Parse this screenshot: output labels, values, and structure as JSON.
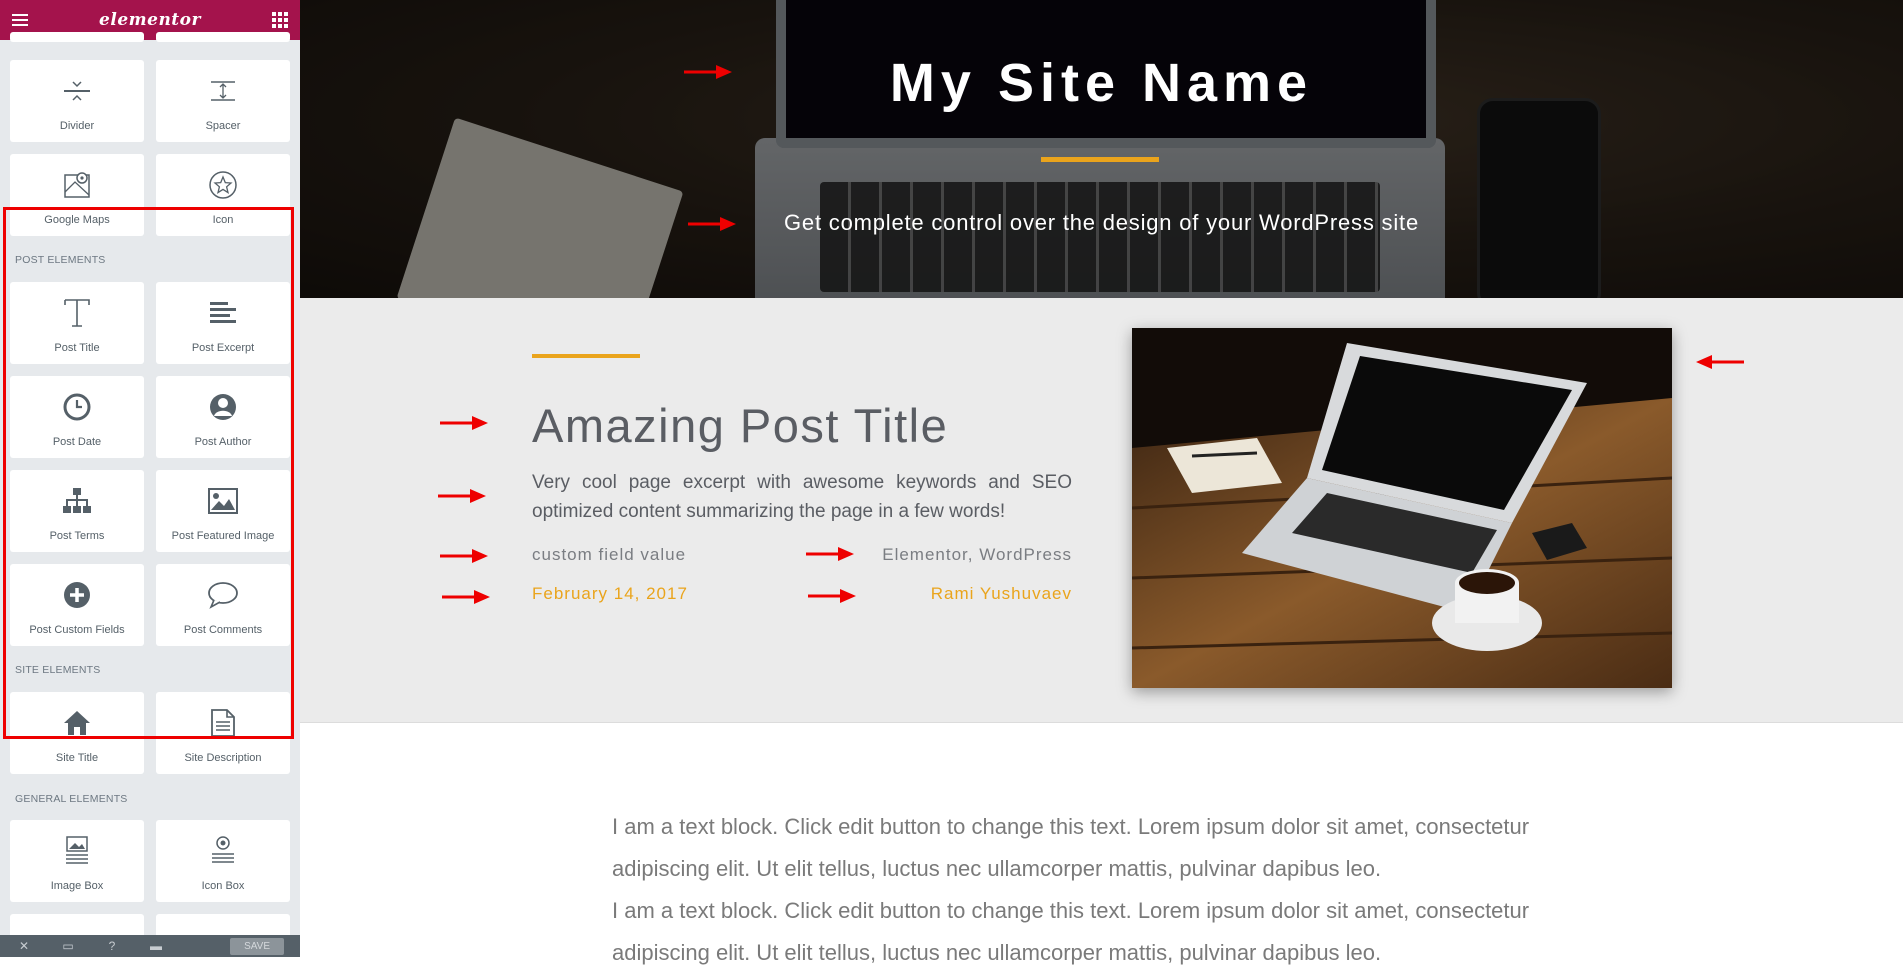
{
  "sidebar": {
    "logo": "elementor",
    "widgets_top": [
      {
        "label": "Divider",
        "icon": "divider-icon"
      },
      {
        "label": "Spacer",
        "icon": "spacer-icon"
      },
      {
        "label": "Google Maps",
        "icon": "map-icon"
      },
      {
        "label": "Icon",
        "icon": "star-circle-icon"
      }
    ],
    "categories": {
      "post": "POST ELEMENTS",
      "site": "SITE ELEMENTS",
      "general": "GENERAL ELEMENTS"
    },
    "post_widgets": [
      {
        "label": "Post Title",
        "icon": "text-t-icon"
      },
      {
        "label": "Post Excerpt",
        "icon": "align-lines-icon"
      },
      {
        "label": "Post Date",
        "icon": "clock-icon"
      },
      {
        "label": "Post Author",
        "icon": "user-circle-icon"
      },
      {
        "label": "Post Terms",
        "icon": "sitemap-icon"
      },
      {
        "label": "Post Featured Image",
        "icon": "image-icon"
      },
      {
        "label": "Post Custom Fields",
        "icon": "plus-circle-icon"
      },
      {
        "label": "Post Comments",
        "icon": "comment-icon"
      }
    ],
    "site_widgets": [
      {
        "label": "Site Title",
        "icon": "home-icon"
      },
      {
        "label": "Site Description",
        "icon": "document-icon"
      }
    ],
    "general_widgets": [
      {
        "label": "Image Box",
        "icon": "image-box-icon"
      },
      {
        "label": "Icon Box",
        "icon": "icon-box-icon"
      }
    ],
    "footer": {
      "save_label": "SAVE"
    }
  },
  "preview": {
    "site_title": "My Site Name",
    "site_description": "Get complete control over the design of your WordPress site",
    "post": {
      "title": "Amazing Post Title",
      "excerpt": "Very cool page excerpt with awesome keywords and SEO optimized content summarizing the page in a few words!",
      "custom_field": "custom field value",
      "terms": "Elementor, WordPress",
      "date": "February 14, 2017",
      "author": "Rami Yushuvaev"
    },
    "text_block": [
      "I am a text block. Click edit button to change this text. Lorem ipsum dolor sit amet, consectetur adipiscing elit. Ut elit tellus, luctus nec ullamcorper mattis, pulvinar dapibus leo.",
      "I am a text block. Click edit button to change this text. Lorem ipsum dolor sit amet, consectetur adipiscing elit. Ut elit tellus, luctus nec ullamcorper mattis, pulvinar dapibus leo."
    ]
  },
  "colors": {
    "brand": "#a4134c",
    "accent": "#eaa41c",
    "annotation_arrow": "#e00000"
  }
}
